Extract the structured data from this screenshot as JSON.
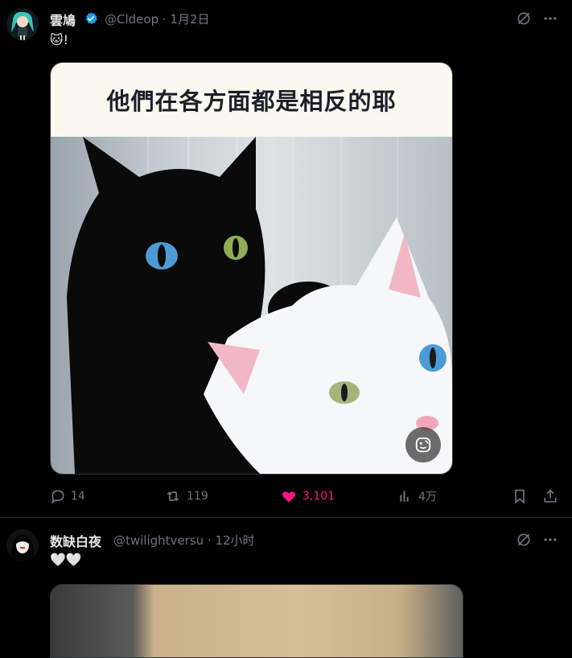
{
  "tweet1": {
    "author_name": "雲鳩",
    "handle_time": "@Cldeop · 1月2日",
    "text": "🐱!",
    "meme_caption": "他們在各方面都是相反的耶",
    "actions": {
      "replies": "14",
      "retweets": "119",
      "likes": "3,101",
      "views": "4万"
    },
    "colors": {
      "like": "#f91880",
      "verified": "#1d9bf0"
    }
  },
  "tweet2": {
    "author_name": "数缺白夜",
    "handle_time": "@twilightversu · 12小时",
    "text": "🤍🤍"
  },
  "icons": [
    "verified-badge-icon",
    "grok-icon",
    "more-icon",
    "reply-icon",
    "retweet-icon",
    "heart-icon",
    "views-icon",
    "bookmark-icon",
    "share-icon",
    "alt-text-icon"
  ]
}
